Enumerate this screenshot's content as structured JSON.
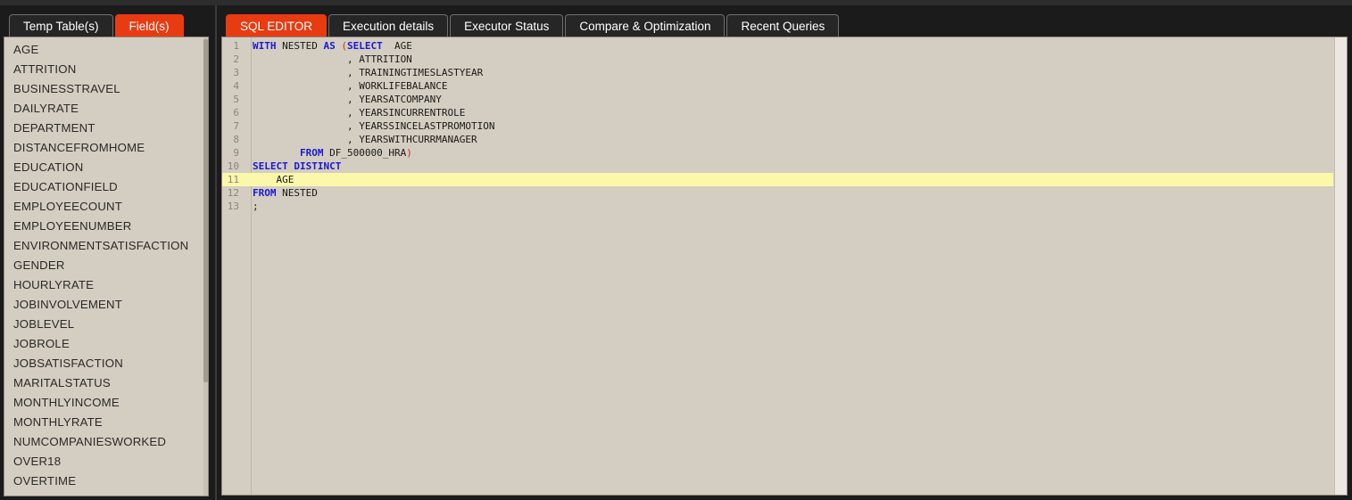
{
  "left_panel": {
    "tabs": [
      {
        "label": "Temp Table(s)",
        "active": false
      },
      {
        "label": "Field(s)",
        "active": true
      }
    ],
    "fields": [
      "AGE",
      "ATTRITION",
      "BUSINESSTRAVEL",
      "DAILYRATE",
      "DEPARTMENT",
      "DISTANCEFROMHOME",
      "EDUCATION",
      "EDUCATIONFIELD",
      "EMPLOYEECOUNT",
      "EMPLOYEENUMBER",
      "ENVIRONMENTSATISFACTION",
      "GENDER",
      "HOURLYRATE",
      "JOBINVOLVEMENT",
      "JOBLEVEL",
      "JOBROLE",
      "JOBSATISFACTION",
      "MARITALSTATUS",
      "MONTHLYINCOME",
      "MONTHLYRATE",
      "NUMCOMPANIESWORKED",
      "OVER18",
      "OVERTIME"
    ]
  },
  "main": {
    "tabs": [
      {
        "label": "SQL EDITOR",
        "active": true
      },
      {
        "label": "Execution details",
        "active": false
      },
      {
        "label": "Executor Status",
        "active": false
      },
      {
        "label": "Compare & Optimization",
        "active": false
      },
      {
        "label": "Recent Queries",
        "active": false
      }
    ],
    "editor": {
      "highlighted_line": 11,
      "lines": [
        {
          "n": "1",
          "tokens": [
            {
              "t": "WITH",
              "c": "kw"
            },
            {
              "t": " NESTED "
            },
            {
              "t": "AS",
              "c": "kw"
            },
            {
              "t": " "
            },
            {
              "t": "(",
              "c": "pr"
            },
            {
              "t": "SELECT",
              "c": "kw"
            },
            {
              "t": "  AGE"
            }
          ]
        },
        {
          "n": "2",
          "tokens": [
            {
              "t": "                , ATTRITION"
            }
          ]
        },
        {
          "n": "3",
          "tokens": [
            {
              "t": "                , TRAININGTIMESLASTYEAR"
            }
          ]
        },
        {
          "n": "4",
          "tokens": [
            {
              "t": "                , WORKLIFEBALANCE"
            }
          ]
        },
        {
          "n": "5",
          "tokens": [
            {
              "t": "                , YEARSATCOMPANY"
            }
          ]
        },
        {
          "n": "6",
          "tokens": [
            {
              "t": "                , YEARSINCURRENTROLE"
            }
          ]
        },
        {
          "n": "7",
          "tokens": [
            {
              "t": "                , YEARSSINCELASTPROMOTION"
            }
          ]
        },
        {
          "n": "8",
          "tokens": [
            {
              "t": "                , YEARSWITHCURRMANAGER"
            }
          ]
        },
        {
          "n": "9",
          "tokens": [
            {
              "t": "        "
            },
            {
              "t": "FROM",
              "c": "kw"
            },
            {
              "t": " DF_500000_HRA"
            },
            {
              "t": ")",
              "c": "pr"
            }
          ]
        },
        {
          "n": "10",
          "tokens": [
            {
              "t": "SELECT",
              "c": "kw"
            },
            {
              "t": " "
            },
            {
              "t": "DISTINCT",
              "c": "kw"
            }
          ]
        },
        {
          "n": "11",
          "tokens": [
            {
              "t": "    AGE"
            }
          ]
        },
        {
          "n": "12",
          "tokens": [
            {
              "t": "FROM",
              "c": "kw"
            },
            {
              "t": " NESTED"
            }
          ]
        },
        {
          "n": "13",
          "tokens": [
            {
              "t": ";"
            }
          ]
        }
      ]
    }
  },
  "colors": {
    "active_tab": "#e83b12",
    "tab_bg": "#262626",
    "panel_bg": "#d4cdc1",
    "keyword": "#1a1ad4",
    "paren": "#d42424",
    "line_highlight": "#fcf8a9"
  }
}
